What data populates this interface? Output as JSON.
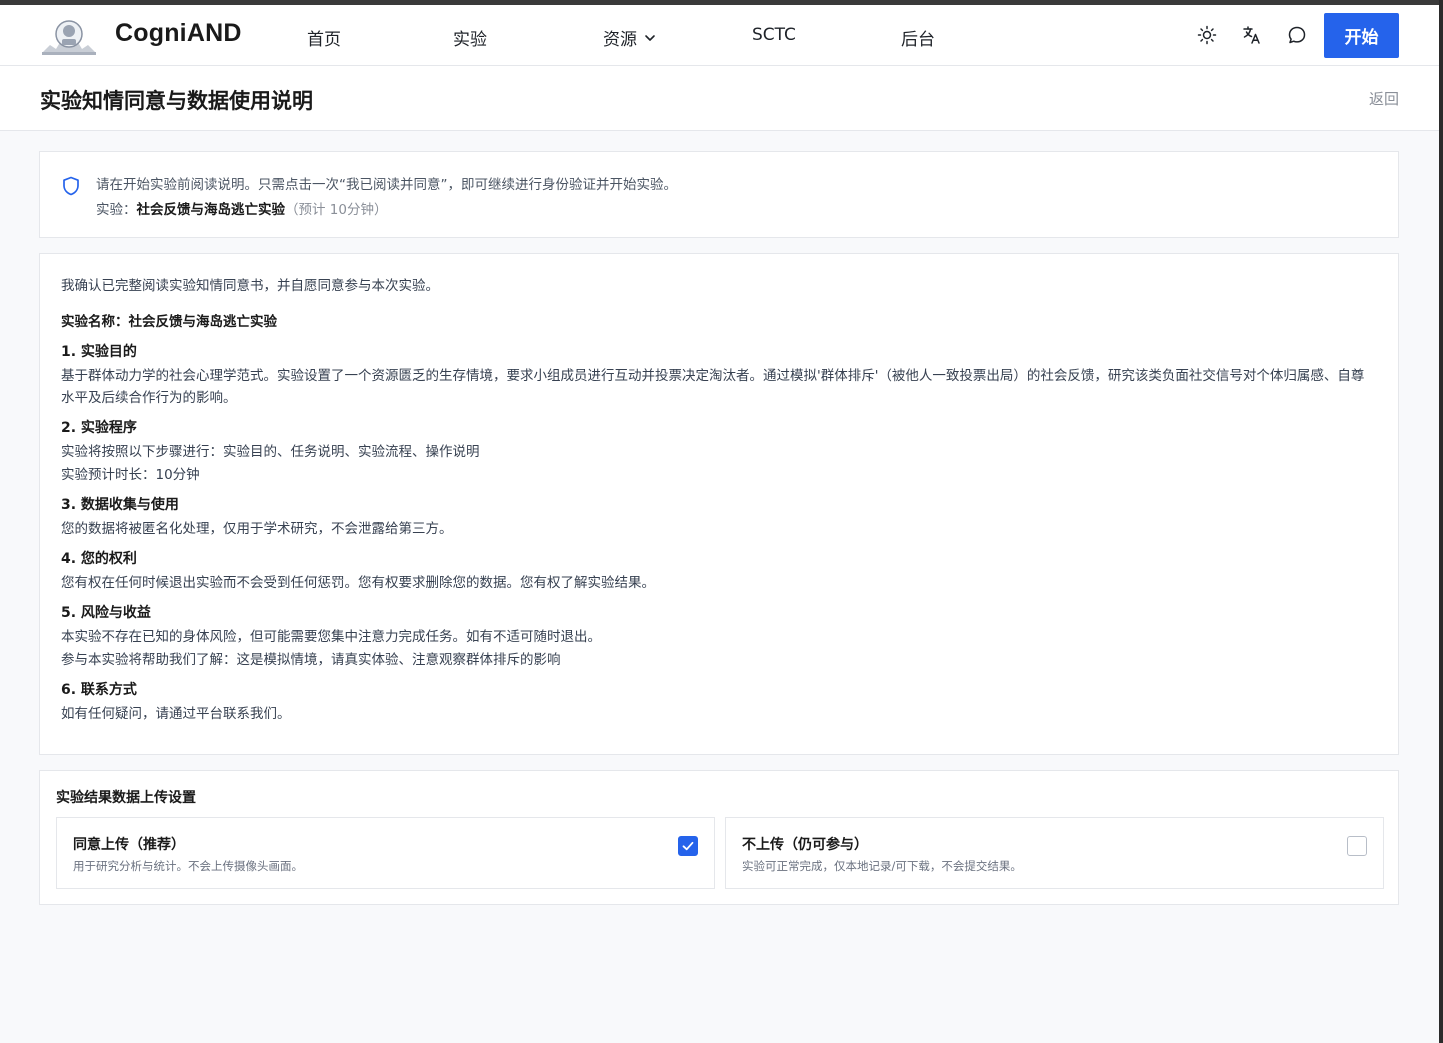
{
  "header": {
    "brand": "CogniAND",
    "nav": [
      {
        "label": "首页"
      },
      {
        "label": "实验"
      },
      {
        "label": "资源",
        "has_dropdown": true
      },
      {
        "label": "SCTC"
      },
      {
        "label": "后台"
      }
    ],
    "icons": [
      "sun-icon",
      "translate-icon",
      "chat-bubble-icon"
    ],
    "start_label": "开始",
    "accent_color": "#2563eb"
  },
  "titlebar": {
    "title": "实验知情同意与数据使用说明",
    "back_label": "返回"
  },
  "notice": {
    "line1": "请在开始实验前阅读说明。只需点击一次“我已阅读并同意”，即可继续进行身份验证并开始实验。",
    "experiment_prefix": "实验：",
    "experiment_name": "社会反馈与海岛逃亡实验",
    "duration": "（预计 10分钟）"
  },
  "consent": {
    "intro": "我确认已完整阅读实验知情同意书，并自愿同意参与本次实验。",
    "experiment_title": "实验名称：社会反馈与海岛逃亡实验",
    "sections": [
      {
        "heading": "1. 实验目的",
        "lines": [
          "基于群体动力学的社会心理学范式。实验设置了一个资源匮乏的生存情境，要求小组成员进行互动并投票决定淘汰者。通过模拟'群体排斥'（被他人一致投票出局）的社会反馈，研究该类负面社交信号对个体归属感、自尊水平及后续合作行为的影响。"
        ]
      },
      {
        "heading": "2. 实验程序",
        "lines": [
          "实验将按照以下步骤进行：实验目的、任务说明、实验流程、操作说明",
          "实验预计时长：10分钟"
        ]
      },
      {
        "heading": "3. 数据收集与使用",
        "lines": [
          "您的数据将被匿名化处理，仅用于学术研究，不会泄露给第三方。"
        ]
      },
      {
        "heading": "4. 您的权利",
        "lines": [
          "您有权在任何时候退出实验而不会受到任何惩罚。您有权要求删除您的数据。您有权了解实验结果。"
        ]
      },
      {
        "heading": "5. 风险与收益",
        "lines": [
          "本实验不存在已知的身体风险，但可能需要您集中注意力完成任务。如有不适可随时退出。",
          "参与本实验将帮助我们了解：这是模拟情境，请真实体验、注意观察群体排斥的影响"
        ]
      },
      {
        "heading": "6. 联系方式",
        "lines": [
          "如有任何疑问，请通过平台联系我们。"
        ]
      }
    ]
  },
  "upload": {
    "title": "实验结果数据上传设置",
    "options": [
      {
        "title": "同意上传（推荐）",
        "desc": "用于研究分析与统计。不会上传摄像头画面。",
        "checked": true
      },
      {
        "title": "不上传（仍可参与）",
        "desc": "实验可正常完成，仅本地记录/可下载，不会提交结果。",
        "checked": false
      }
    ]
  }
}
